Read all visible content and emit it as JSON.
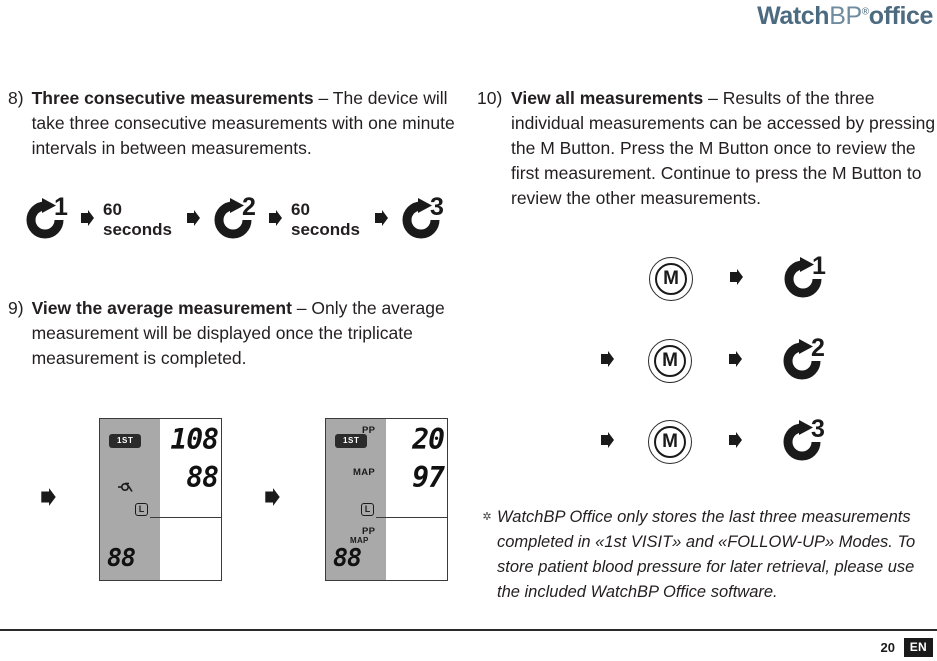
{
  "logo": {
    "bold1": "Watch",
    "light": "BP",
    "reg": "®",
    "bold2": "office",
    "color": "#4d6b80"
  },
  "left_column": {
    "item8": {
      "number": "8)",
      "title": "Three consecutive measurements",
      "dash": " – ",
      "text": "The device will take three consecutive measurements with one minute intervals in between measurements."
    },
    "item9": {
      "number": "9)",
      "title": "View the average measurement",
      "dash": " – ",
      "text": "Only the average measurement will be displayed once the triplicate measurement is completed."
    },
    "sequence": {
      "step1_num": "1",
      "interval1_value": "60",
      "interval1_unit": "seconds",
      "step2_num": "2",
      "interval2_value": "60",
      "interval2_unit": "seconds",
      "step3_num": "3"
    },
    "displays": [
      {
        "name": "average-display-systolic",
        "badge": "1ST",
        "l_mark": "L",
        "top_digits": "108",
        "mid_digits": "88",
        "bottom_digits": "88",
        "tags": []
      },
      {
        "name": "average-display-pp-map",
        "badge": "1ST",
        "l_mark": "L",
        "top_digits": "20",
        "mid_digits": "97",
        "bottom_digits": "88",
        "tag_pp_top": "PP",
        "tag_map_mid": "MAP",
        "tag_pp_lower": "PP",
        "tag_map_bottom": "MAP"
      }
    ]
  },
  "right_column": {
    "item10": {
      "number": "10)",
      "title": "View all measurements",
      "dash": " – ",
      "text": "Results of the three individual measurements can be accessed by pressing the M Button. Press the M Button once to review the first measurement. Continue to press the M Button to review the other measurements."
    },
    "m_rows": [
      {
        "button": "M",
        "result": "1"
      },
      {
        "button": "M",
        "result": "2"
      },
      {
        "button": "M",
        "result": "3"
      }
    ],
    "note": {
      "marker": "✲",
      "text": "WatchBP Office only stores the  last three measurements completed in «1st VISIT» and «FOLLOW-UP» Modes. To store patient blood pressure for later retrieval, please use the included WatchBP Office software."
    }
  },
  "footer": {
    "page_number": "20",
    "language": "EN"
  }
}
